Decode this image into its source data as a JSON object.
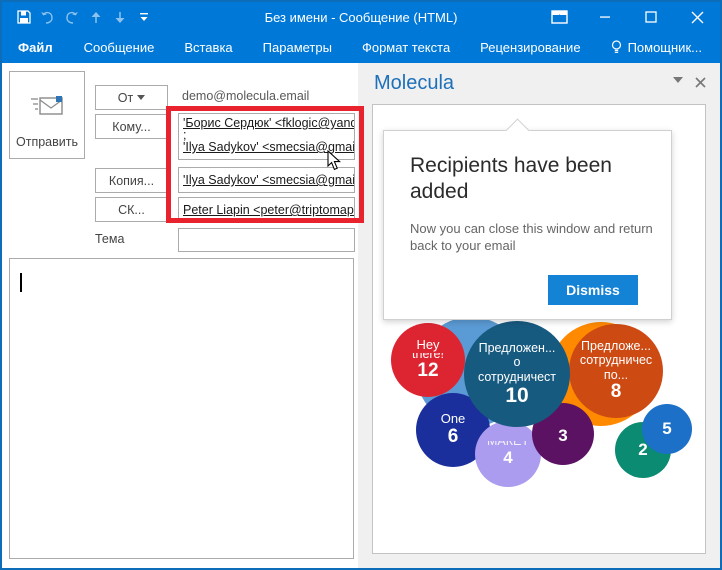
{
  "window": {
    "title": "Без имени - Сообщение (HTML)",
    "qat_icons": [
      "save",
      "undo",
      "redo",
      "move-up",
      "move-down",
      "customize-quick-access"
    ],
    "controls": [
      "ribbon-display-options",
      "minimize",
      "maximize",
      "close"
    ]
  },
  "tabs": [
    "Файл",
    "Сообщение",
    "Вставка",
    "Параметры",
    "Формат текста",
    "Рецензирование",
    "Помощник..."
  ],
  "compose": {
    "send_label": "Отправить",
    "from_button": "От",
    "from_value": "demo@molecula.email",
    "to_button": "Кому...",
    "to_line1": "'Борис Сердюк' <fklogic@yande",
    "to_separator": ";",
    "to_line2": "'Ilya Sadykov' <smecsia@gmail.c",
    "cc_button": "Копия...",
    "cc_value": "'Ilya Sadykov' <smecsia@gmail.c",
    "bcc_button": "СК...",
    "bcc_value": "Peter Liapin <peter@triptomap.c",
    "subject_label": "Тема",
    "subject_value": "",
    "body_value": ""
  },
  "panel": {
    "title": "Molecula",
    "popover": {
      "heading": "Recipients have been added",
      "body": "Now you can close this window and return back to your email",
      "dismiss_label": "Dismiss"
    }
  },
  "chart_data": {
    "type": "bubble",
    "title": "",
    "note": "circle-packed bubble chart of email threads; two unlabeled bubbles are partially hidden behind the popover card",
    "bubbles": [
      {
        "lines": [
          "Hey",
          "there!"
        ],
        "value": "12",
        "color": "#dd2531"
      },
      {
        "lines": [
          "Предложен...",
          "о",
          "сотрудничест"
        ],
        "value": "10",
        "color": "#175a80"
      },
      {
        "lines": [
          "Предложе...",
          "сотрудничес",
          "по..."
        ],
        "value": "8",
        "color": "#ce4a13"
      },
      {
        "lines": [
          "One"
        ],
        "value": "6",
        "color": "#1a2f9b"
      },
      {
        "lines": [
          "МАКЕТ"
        ],
        "value": "4",
        "color": "#ab9cf0"
      },
      {
        "lines": [
          "·"
        ],
        "value": "3",
        "color": "#5c1263"
      },
      {
        "lines": [],
        "value": "2",
        "color": "#0b8b71"
      },
      {
        "lines": [],
        "value": "5",
        "color": "#1c70c8"
      },
      {
        "lines": [],
        "value": "",
        "color": "#5b9bd5"
      },
      {
        "lines": [],
        "value": "",
        "color": "#ff8a00"
      }
    ]
  }
}
